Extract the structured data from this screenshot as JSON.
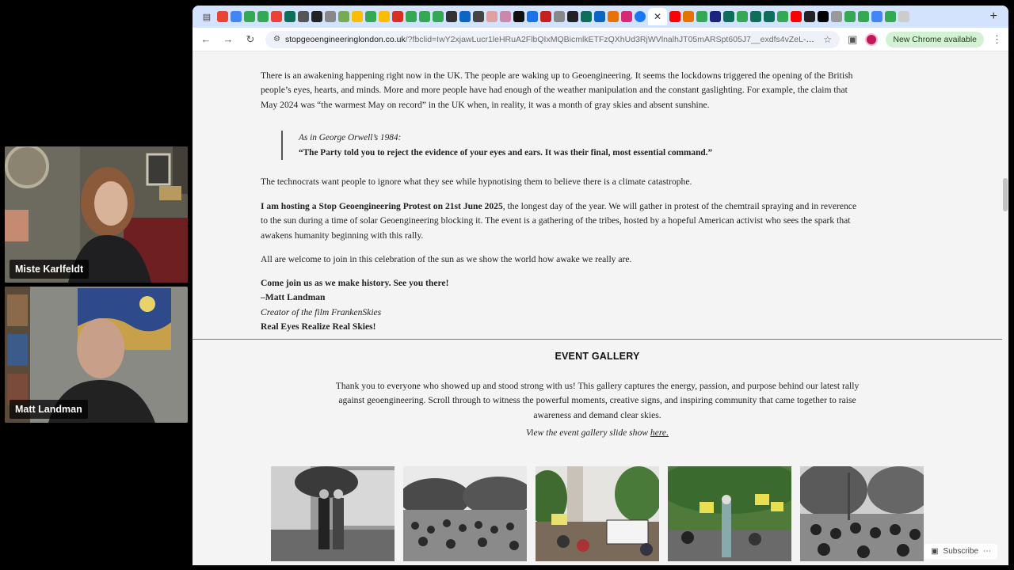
{
  "call": {
    "participants": [
      {
        "name": "Miste Karlfeldt"
      },
      {
        "name": "Matt Landman"
      }
    ]
  },
  "browser": {
    "url_host": "stopgeoengineeringlondon.co.uk",
    "url_rest": "/?fbclid=IwY2xjawLucr1leHRuA2FlbQIxMQBicmlkETFzQXhUd3RjWVlnalhJT05mARSpt605J7__exdfs4vZeL-EXyOwlhqOM...",
    "new_chrome_label": "New Chrome available",
    "close_tab_glyph": "✕",
    "new_tab_glyph": "+"
  },
  "article": {
    "p1": "There is an awakening happening right now in the UK. The people are waking up to Geoengineering. It seems the lockdowns triggered the opening of the British people’s eyes, hearts, and minds. More and more people have had enough of the weather manipulation and the constant gaslighting. For example, the claim that May 2024 was “the warmest May on record” in the UK when, in reality, it was a month of gray skies and absent sunshine.",
    "quote_intro": "As in George Orwell’s 1984:",
    "quote_text": "“The Party told you to reject the evidence of your eyes and ears. It was their final, most essential command.”",
    "p2": "The technocrats want people to ignore what they see while hypnotising them to believe there is a climate catastrophe.",
    "p3_bold": "I am hosting a Stop Geoengineering Protest on 21st June 2025",
    "p3_rest": ", the longest day of the year. We will gather in protest of the chemtrail spraying and in reverence to the sun during a time of solar Geoengineering blocking it. The event is a gathering of the tribes, hosted by a hopeful American activist who sees the spark that awakens humanity beginning with this rally.",
    "p4": "All are welcome to join in this celebration of the sun as we show the world how awake we really are.",
    "sig_line1": "Come join us as we make history. See you there!",
    "sig_line2": "–Matt Landman",
    "sig_line3": "Creator of the film FrankenSkies",
    "sig_line4": "Real Eyes Realize Real Skies!"
  },
  "gallery": {
    "title": "EVENT GALLERY",
    "text": "Thank you to everyone who showed up and stood strong with us! This gallery captures the energy, passion, and purpose behind our latest rally against geoengineering. Scroll through to witness the powerful moments, creative signs, and inspiring community that came together to raise awareness and demand clear skies.",
    "slide_prefix": "View the event gallery slide show ",
    "slide_link": "here."
  },
  "subscribe_label": "Subscribe",
  "colors": {
    "tabstrip": "#d3e3fd",
    "page_bg": "#f4f4f4",
    "new_chrome_bg": "#d4f0d5"
  }
}
